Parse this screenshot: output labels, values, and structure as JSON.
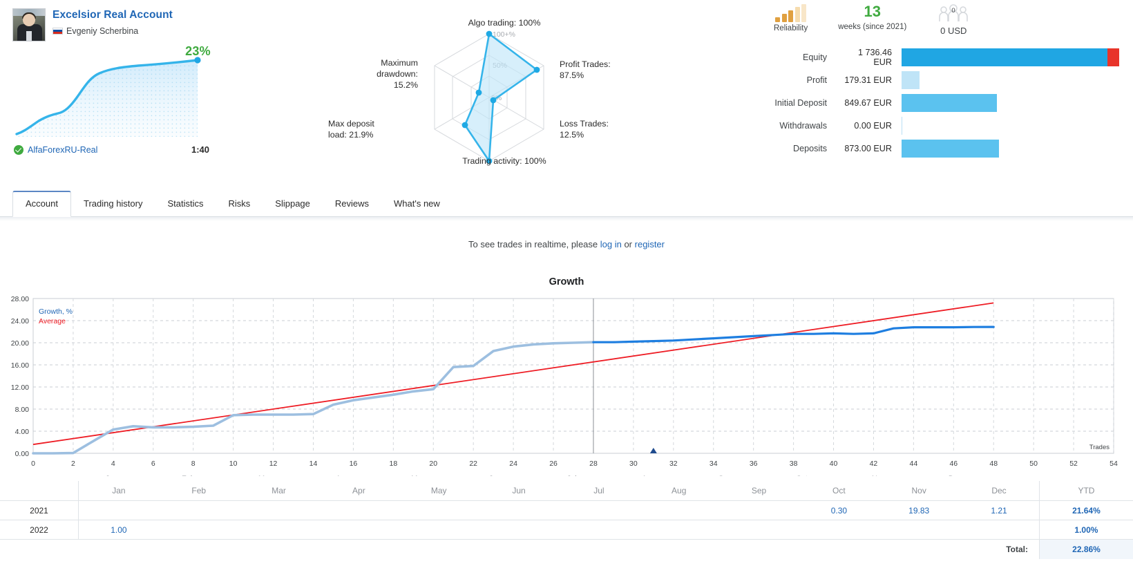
{
  "account": {
    "name": "Excelsior Real Account",
    "owner": "Evgeniy Scherbina",
    "owner_flag": "ru-flag-icon",
    "avatar": "account-avatar",
    "growth_percent": "23%",
    "broker": "AlfaForexRU-Real",
    "leverage": "1:40",
    "verified_icon": "verified-check-icon"
  },
  "radar": {
    "axes": [
      {
        "key": "algo_trading",
        "label": "Algo trading: 100%",
        "value": 100
      },
      {
        "key": "profit_trades",
        "label": "Profit Trades:\n87.5%",
        "value": 88
      },
      {
        "key": "loss_trades",
        "label": "Loss Trades:\n12.5%",
        "value": 3
      },
      {
        "key": "trading_activity",
        "label": "Trading activity: 100%",
        "value": 100
      },
      {
        "key": "max_deposit_load",
        "label": "Max deposit\nload: 21.9%",
        "value": 22
      },
      {
        "key": "max_drawdown",
        "label": "Maximum\ndrawdown:\n15.2%",
        "value": 15
      }
    ],
    "ring_labels": [
      "100+%",
      "50%",
      "0%"
    ],
    "labels": {
      "algo": "Algo trading: 100%",
      "profit_l1": "Profit Trades:",
      "profit_l2": "87.5%",
      "loss_l1": "Loss Trades:",
      "loss_l2": "12.5%",
      "activity": "Trading activity: 100%",
      "load_l1": "Max deposit",
      "load_l2": "load: 21.9%",
      "dd_l1": "Maximum",
      "dd_l2": "drawdown:",
      "dd_l3": "15.2%"
    }
  },
  "badges": {
    "reliability_caption": "Reliability",
    "reliability_level": 3,
    "weeks_number": "13",
    "weeks_caption": "weeks (since 2021)",
    "subscribers_count": "0",
    "subscribers_amount": "0 USD"
  },
  "stats": {
    "rows": [
      {
        "label": "Equity",
        "value": "1 736.46 EUR",
        "bar_pct": 100,
        "style": "equity"
      },
      {
        "label": "Profit",
        "value": "179.31 EUR",
        "bar_pct": 8,
        "style": "profit"
      },
      {
        "label": "Initial Deposit",
        "value": "849.67 EUR",
        "bar_pct": 43,
        "style": "plain"
      },
      {
        "label": "Withdrawals",
        "value": "0.00 EUR",
        "bar_pct": 0,
        "style": "empty"
      },
      {
        "label": "Deposits",
        "value": "873.00 EUR",
        "bar_pct": 44,
        "style": "plain"
      }
    ],
    "colors": {
      "bar": "#5bc2ef",
      "equity": "#23a9e8",
      "loss": "#e8342a",
      "profit_light": "#bfe4f7"
    }
  },
  "tabs": {
    "items": [
      "Account",
      "Trading history",
      "Statistics",
      "Risks",
      "Slippage",
      "Reviews",
      "What's new"
    ],
    "active": "Account"
  },
  "notice": {
    "prefix": "To see trades in realtime, please ",
    "login": "log in",
    "middle": " or ",
    "register": "register"
  },
  "chart_data": {
    "type": "line",
    "title": "Growth",
    "xlabel": "Trades",
    "ylabel": "",
    "xlim": [
      0,
      54
    ],
    "ylim": [
      0,
      28
    ],
    "xticks": [
      0,
      2,
      4,
      6,
      8,
      10,
      12,
      14,
      16,
      18,
      20,
      22,
      24,
      26,
      28,
      30,
      32,
      34,
      36,
      38,
      40,
      42,
      44,
      46,
      48,
      50,
      52,
      54
    ],
    "yticks": [
      "0.00",
      "4.00",
      "8.00",
      "12.00",
      "16.00",
      "20.00",
      "24.00",
      "28.00"
    ],
    "grid": true,
    "legend_position": "top-left",
    "legend": [
      {
        "name": "Growth, %",
        "color": "#1f66b5"
      },
      {
        "name": "Average",
        "color": "#ee1c24"
      }
    ],
    "series": [
      {
        "name": "Growth, %",
        "color": "#9dbfe0",
        "color_active": "#1e7ee0",
        "split_x": 28,
        "points": [
          [
            0,
            0.0
          ],
          [
            1,
            0.0
          ],
          [
            2,
            0.05
          ],
          [
            3,
            2.2
          ],
          [
            4,
            4.3
          ],
          [
            5,
            4.9
          ],
          [
            6,
            4.7
          ],
          [
            7,
            4.7
          ],
          [
            8,
            4.8
          ],
          [
            9,
            5.0
          ],
          [
            10,
            6.9
          ],
          [
            11,
            7.0
          ],
          [
            12,
            7.0
          ],
          [
            13,
            7.0
          ],
          [
            14,
            7.1
          ],
          [
            15,
            8.8
          ],
          [
            16,
            9.6
          ],
          [
            17,
            10.1
          ],
          [
            18,
            10.6
          ],
          [
            19,
            11.2
          ],
          [
            20,
            11.6
          ],
          [
            21,
            15.6
          ],
          [
            22,
            15.8
          ],
          [
            23,
            18.5
          ],
          [
            24,
            19.3
          ],
          [
            25,
            19.7
          ],
          [
            26,
            19.9
          ],
          [
            27,
            20.0
          ],
          [
            28,
            20.1
          ],
          [
            29,
            20.1
          ],
          [
            30,
            20.2
          ],
          [
            31,
            20.3
          ],
          [
            32,
            20.4
          ],
          [
            33,
            20.6
          ],
          [
            34,
            20.8
          ],
          [
            35,
            21.0
          ],
          [
            36,
            21.2
          ],
          [
            37,
            21.4
          ],
          [
            38,
            21.6
          ],
          [
            39,
            21.6
          ],
          [
            40,
            21.7
          ],
          [
            41,
            21.6
          ],
          [
            42,
            21.7
          ],
          [
            43,
            22.6
          ],
          [
            44,
            22.8
          ],
          [
            45,
            22.8
          ],
          [
            46,
            22.8
          ],
          [
            47,
            22.85
          ],
          [
            48,
            22.86
          ]
        ]
      },
      {
        "name": "Average",
        "color": "#ee1c24",
        "points": [
          [
            0,
            1.6
          ],
          [
            48,
            27.2
          ]
        ]
      }
    ],
    "marker": {
      "x": 31,
      "y": 0,
      "color": "#1f4b8e",
      "shape": "triangle-up"
    },
    "divider_x": 28,
    "months": [
      "Jan",
      "Feb",
      "Mar",
      "Apr",
      "May",
      "Jun",
      "Jul",
      "Aug",
      "Sep",
      "Oct",
      "Nov",
      "Dec"
    ]
  },
  "month_table": {
    "months": [
      "Jan",
      "Feb",
      "Mar",
      "Apr",
      "May",
      "Jun",
      "Jul",
      "Aug",
      "Sep",
      "Oct",
      "Nov",
      "Dec"
    ],
    "ytd_header": "YTD",
    "rows": [
      {
        "year": "2021",
        "values": [
          "",
          "",
          "",
          "",
          "",
          "",
          "",
          "",
          "",
          "0.30",
          "19.83",
          "1.21"
        ],
        "ytd": "21.64%"
      },
      {
        "year": "2022",
        "values": [
          "1.00",
          "",
          "",
          "",
          "",
          "",
          "",
          "",
          "",
          "",
          "",
          ""
        ],
        "ytd": "1.00%"
      }
    ],
    "total_label": "Total:",
    "total_value": "22.86%"
  }
}
